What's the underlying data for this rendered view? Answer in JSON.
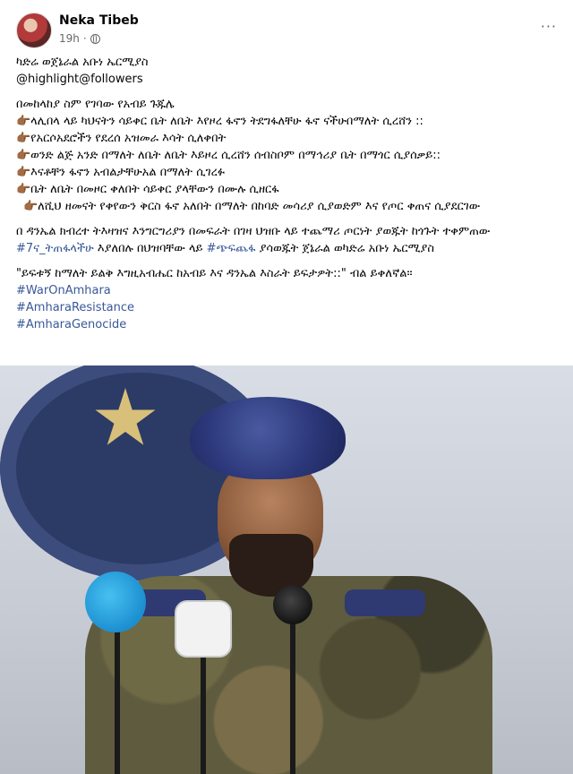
{
  "post": {
    "author": "Neka Tibeb",
    "time": "19h",
    "separator": "·",
    "more": "···"
  },
  "content": {
    "title": "ካድሬ ወጀኔራል አቡነ ኤርሚያስ",
    "mentions": "@highlight@followers",
    "intro": "በመከላከያ ስም የገባው የአብይ ጉጁሌ",
    "bullets": [
      "👉🏾ላሊበላ ላይ ካህናትን ሳይቀር ቤት ለቤት እየዞረ ፋኖን ትደግፋለቸሁ ፋኖ ናችሁበማለት ሲረሸን ::",
      "👉🏾የአርሶአደሮችን  የደረሰ አዝመራ እሳት ሲለቀበት",
      "👉🏾ወንድ ልጅ አንድ በማለት ለቤት ለቤት እይዞረ ሲረሸን  ሰብስቦም በማኅሪያ ቤት በማጎር ሲያሰቃይ::",
      "👉🏾እናቶቸን ፋኖን አብልታቸሁአል በማለት ሲገረፉ",
      "👉🏾ቤት ለቤት በመዞር ቀለበት ሳይቀር ያላቸውን በሙሉ ሲዘርፋ",
      "👉🏾ለሺህ ዘመናት የቀየውን ቅርስ ፋኖ አለበት በማለት በከባድ መሳሪያ ሲያወድም እና የጦር ቀጠና ሲያደርገው"
    ],
    "para_prefix": "በ ዳንኤል  ክብረተ ትእዛዝና እንግርግሪያን  በመፍራት በገዛ ህዝቡ ላይ   ተጨማሪ ጦርነት ያወጁት ከጎጉት ተቀምጠው ",
    "para_tag1": "#7ና_ትጠፋላችሁ",
    "para_mid": " እያለበሉ  በህዝባቸው ላይ ",
    "para_tag2": "#ጭፍጨፋ",
    "para_suffix": " ያሳወጁት ጀኔራል ወካድሬ  አቡነ ኤርሚያስ",
    "quote": "\"ይፍቱኝ ከማለት ይልቅ  እግዚአብሔር   ከአብይ እና ዳንኤል እስራት ይፍታዎት::\" ብል ይቀለኛል።",
    "hashtags": [
      "#WarOnAmhara",
      "#AmharaResistance",
      "#AmharaGenocide"
    ]
  },
  "colors": {
    "link": "#385898",
    "text": "#050505",
    "meta": "#65676b"
  }
}
